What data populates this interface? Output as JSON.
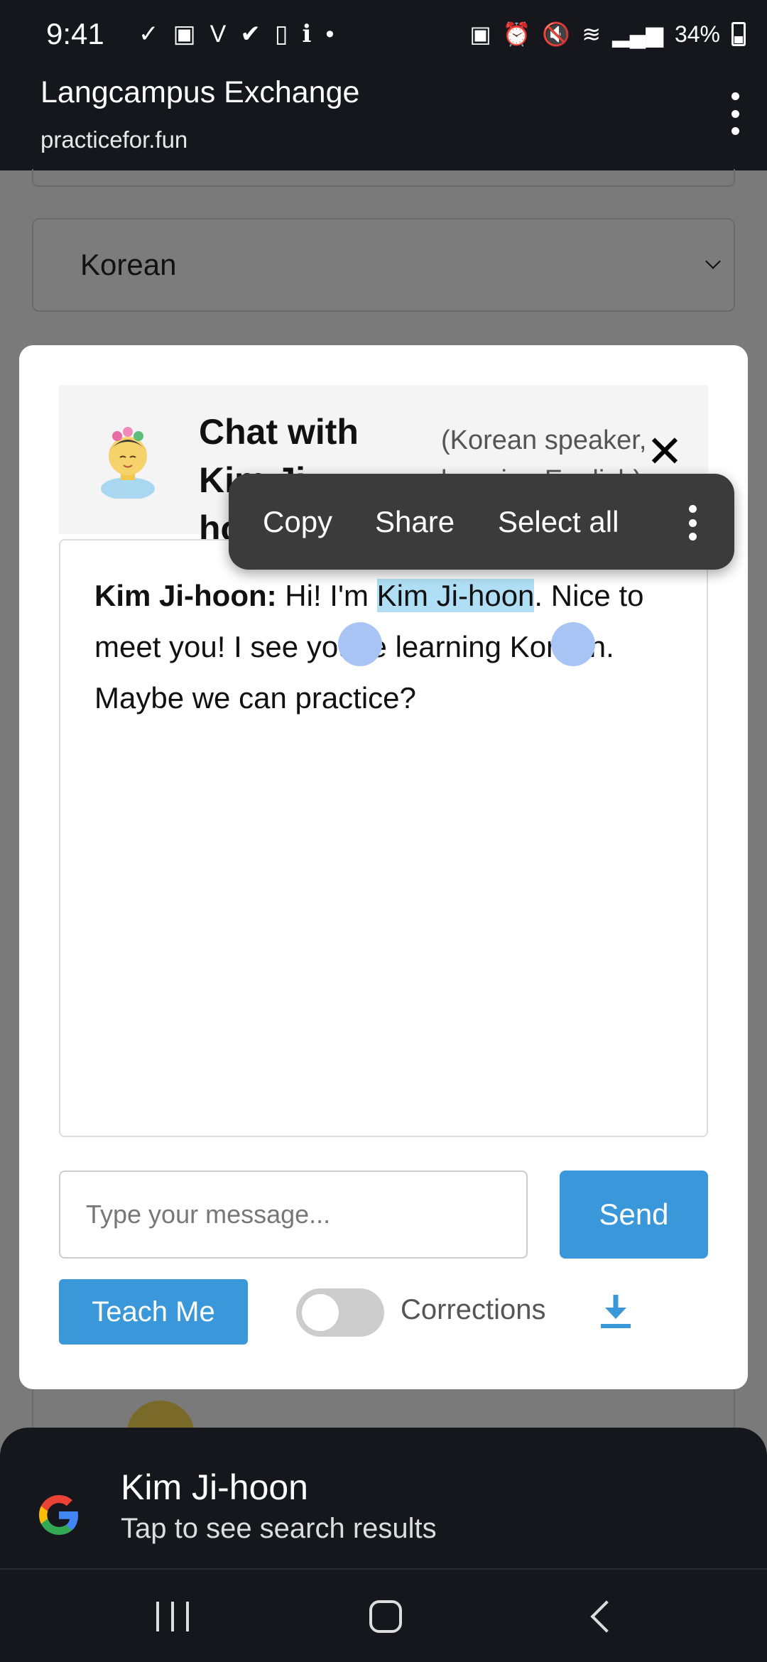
{
  "status_bar": {
    "time": "9:41",
    "battery_percent": "34%"
  },
  "browser": {
    "app_title": "Langcampus Exchange",
    "url": "practicefor.fun"
  },
  "page": {
    "language_select_value": "Korean"
  },
  "chat_modal": {
    "title": "Chat with Kim Ji-hoon",
    "subtitle": "(Korean speaker, learning English)",
    "close_label": "✕",
    "messages": [
      {
        "sender": "Kim Ji-hoon:",
        "text_before": " Hi! I'm ",
        "text_selected": "Kim Ji-hoon",
        "text_after": ". Nice to meet you! I see you're learning Korean. Maybe we can practice?"
      }
    ],
    "input_placeholder": "Type your message...",
    "send_label": "Send",
    "teach_me_label": "Teach Me",
    "corrections_label": "Corrections",
    "corrections_enabled": false
  },
  "context_menu": {
    "items": [
      "Copy",
      "Share",
      "Select all"
    ]
  },
  "search_sheet": {
    "title": "Kim Ji-hoon",
    "subtitle": "Tap to see search results"
  },
  "colors": {
    "primary_button": "#3a98da",
    "selection_highlight": "#b0dff5",
    "selection_handle": "#a7c4f5",
    "dark_bar": "#15171c",
    "context_menu_bg": "#3b3b3b"
  }
}
